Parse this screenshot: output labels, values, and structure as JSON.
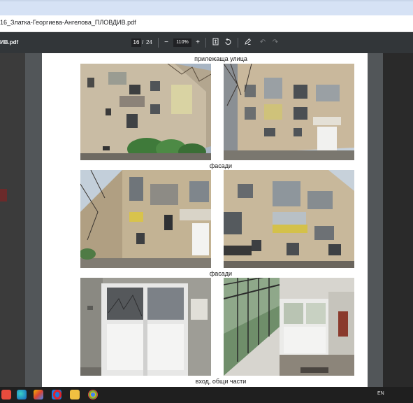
{
  "browser": {
    "document_title": "16_Златка-Георгиева-Ангелова_ПЛОВДИВ.pdf"
  },
  "pdf_toolbar": {
    "file_name": "ИВ.pdf",
    "current_page": "16",
    "page_separator": "/",
    "total_pages": "24",
    "zoom": "110%",
    "zoom_out_icon": "minus-icon",
    "zoom_in_icon": "plus-icon"
  },
  "page": {
    "caption_top": "прилежаща улица",
    "caption_facades_1": "фасади",
    "caption_facades_2": "фасади",
    "caption_bottom": "вход, общи части"
  },
  "taskbar": {
    "language": "EN",
    "apps": [
      "windows-icon",
      "edge-icon",
      "photos-icon",
      "file-explorer-icon",
      "opera-icon",
      "mail-icon",
      "chrome-icon"
    ]
  }
}
